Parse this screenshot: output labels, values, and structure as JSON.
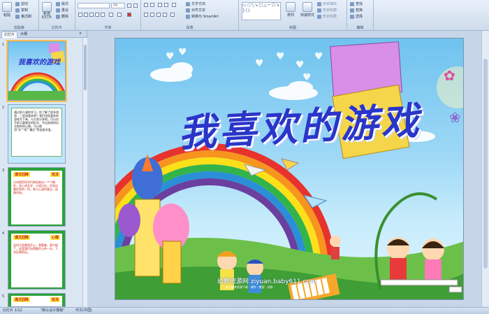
{
  "ribbon": {
    "clipboard": {
      "paste": "粘贴",
      "cut": "剪切",
      "copy": "复制",
      "format_painter": "格式刷",
      "label": "剪贴板"
    },
    "slides": {
      "new_slide": "新建\n幻灯片",
      "layout": "版式",
      "reset": "重设",
      "delete": "删除",
      "label": "幻灯片"
    },
    "font": {
      "size": "44",
      "label": "字体"
    },
    "paragraph": {
      "text_direction": "文字方向",
      "align_text": "对齐文本",
      "smartart": "转换为 SmartArt",
      "label": "段落"
    },
    "drawing": {
      "arrange": "排列",
      "quick_styles": "快速样式",
      "shape_fill": "形状填充",
      "shape_outline": "形状轮廓",
      "shape_effects": "形状效果",
      "label": "绘图"
    },
    "editing": {
      "find": "查找",
      "replace": "替换",
      "select": "选择",
      "label": "编辑"
    }
  },
  "leftpane": {
    "tabs": [
      "幻灯片",
      "大纲"
    ],
    "slides": [
      {
        "num": "1",
        "title": "我喜欢的游戏"
      },
      {
        "num": "2",
        "text": "通过前几课的学习，你了解了很多游戏，一定很喜欢吧？我们也很喜欢的游戏写下来，与大家分享吧。可以仿写前几篇课文的形式，写出游戏的玩法和你的心情，可以使用“先”“再”“最后”等连接词语。"
      },
      {
        "num": "3",
        "heading": "课文回眸",
        "badge": "玩法",
        "text": "古诗是把同学们带进来出一个个精彩，加上成文学，小组讨论，评选出最优秀的一项，参与上面的意见，组建评选。"
      },
      {
        "num": "4",
        "heading": "课文回眸",
        "badge": "心情",
        "text": "这时大家都很开心，我看着，高兴极了。这是我们玩得最开心的一次，下次还想再玩。"
      },
      {
        "num": "5",
        "heading": "课文回眸",
        "badge": "玩法"
      }
    ]
  },
  "slide": {
    "title": "我喜欢的游戏",
    "watermark": "幼教资源网 ziyuan.baby611.com",
    "watermark_sub": "幼儿教育资源下载 · 课件 · 教案 · 试卷"
  },
  "status": {
    "slide_pos": "幻灯片 1/12",
    "theme": "\"默认设计模板\"",
    "language": "中文(中国)"
  }
}
